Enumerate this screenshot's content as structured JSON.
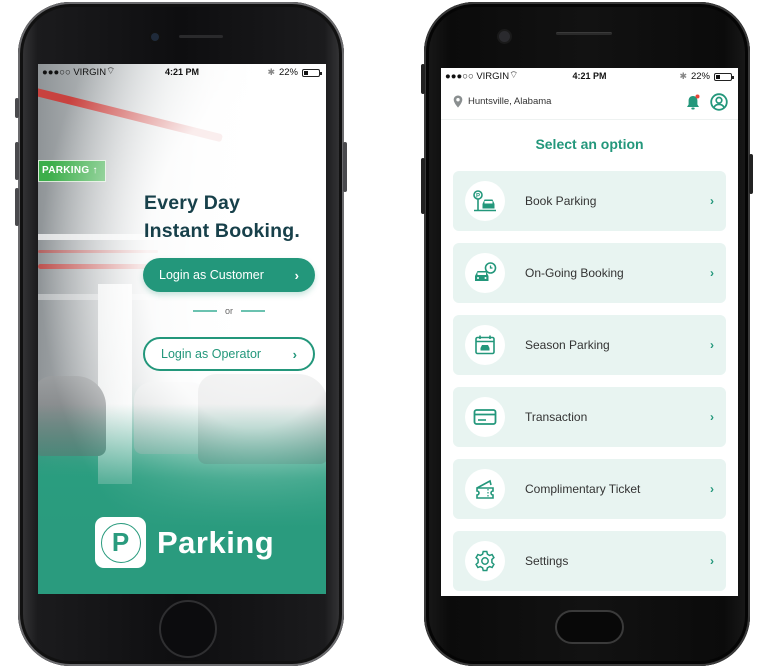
{
  "colors": {
    "brand_green": "#23977b",
    "menu_bg": "#e8f4f1",
    "hero_text": "#17404a",
    "notification_dot": "#e8463a"
  },
  "status_bar": {
    "carrier": "●●●○○ VIRGIN",
    "wifi_icon": "wifi-icon",
    "time": "4:21 PM",
    "bluetooth_icon": "bluetooth-icon",
    "battery": "22%",
    "battery_level": 0.22
  },
  "login_screen": {
    "background_sign": "PARKING ↑",
    "headline_line1": "Every Day",
    "headline_line2": "Instant Booking.",
    "customer_button": "Login as Customer",
    "divider_text": "or",
    "operator_button": "Login as Operator",
    "chevron": "›",
    "logo_letter": "P",
    "logo_text": "Parking"
  },
  "home_screen": {
    "location": "Huntsville, Alabama",
    "title": "Select an option",
    "menu": [
      {
        "label": "Book Parking",
        "icon": "parking-car-icon"
      },
      {
        "label": "On-Going Booking",
        "icon": "car-clock-icon"
      },
      {
        "label": "Season Parking",
        "icon": "calendar-car-icon"
      },
      {
        "label": "Transaction",
        "icon": "credit-card-icon"
      },
      {
        "label": "Complimentary Ticket",
        "icon": "ticket-icon"
      },
      {
        "label": "Settings",
        "icon": "gear-icon"
      }
    ],
    "chevron": "›"
  }
}
